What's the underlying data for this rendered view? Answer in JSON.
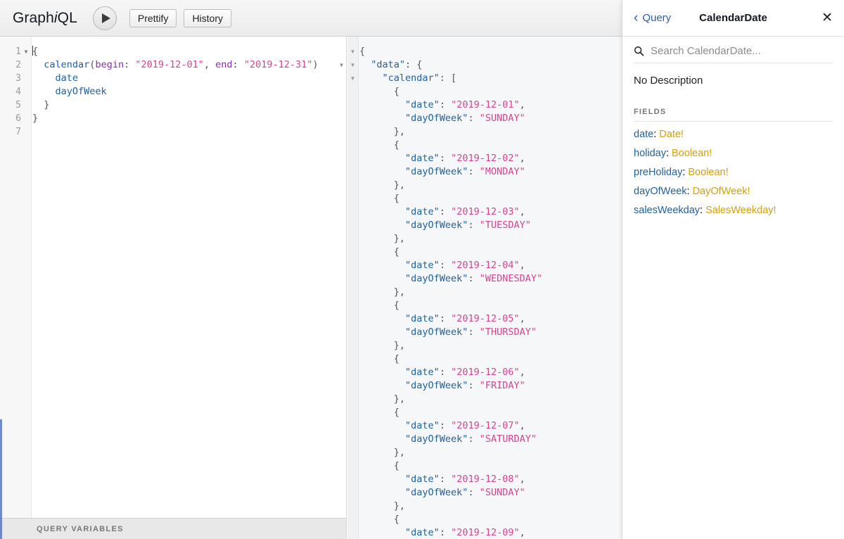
{
  "toolbar": {
    "logo_prefix": "Graph",
    "logo_italic": "i",
    "logo_suffix": "QL",
    "execute_label": "execute-query",
    "prettify_label": "Prettify",
    "history_label": "History"
  },
  "query_editor": {
    "line_numbers": [
      "1",
      "2",
      "3",
      "4",
      "5",
      "6",
      "7"
    ],
    "fold_marker": "▼",
    "lines": [
      {
        "indent": 0,
        "parts": [
          {
            "t": "{",
            "c": "punct"
          }
        ]
      },
      {
        "indent": 1,
        "parts": [
          {
            "t": "calendar",
            "c": "field"
          },
          {
            "t": "(",
            "c": "punct"
          },
          {
            "t": "begin",
            "c": "arg"
          },
          {
            "t": ": ",
            "c": "punct"
          },
          {
            "t": "\"2019-12-01\"",
            "c": "str"
          },
          {
            "t": ", ",
            "c": "punct"
          },
          {
            "t": "end",
            "c": "arg"
          },
          {
            "t": ": ",
            "c": "punct"
          },
          {
            "t": "\"2019-12-31\"",
            "c": "str"
          },
          {
            "t": ")",
            "c": "punct"
          }
        ]
      },
      {
        "indent": 2,
        "parts": [
          {
            "t": "date",
            "c": "field"
          }
        ]
      },
      {
        "indent": 2,
        "parts": [
          {
            "t": "dayOfWeek",
            "c": "field"
          }
        ]
      },
      {
        "indent": 1,
        "parts": [
          {
            "t": "}",
            "c": "punct"
          }
        ]
      },
      {
        "indent": 0,
        "parts": [
          {
            "t": "}",
            "c": "punct"
          }
        ]
      },
      {
        "indent": 0,
        "parts": []
      }
    ],
    "variables_label": "QUERY VARIABLES"
  },
  "result": {
    "fold_markers": [
      "▼",
      "▼",
      "▼"
    ],
    "lines": [
      {
        "indent": 0,
        "parts": [
          {
            "t": "{",
            "c": "pun"
          }
        ]
      },
      {
        "indent": 1,
        "parts": [
          {
            "t": "\"data\"",
            "c": "key"
          },
          {
            "t": ": {",
            "c": "pun"
          }
        ]
      },
      {
        "indent": 2,
        "parts": [
          {
            "t": "\"calendar\"",
            "c": "key"
          },
          {
            "t": ": [",
            "c": "pun"
          }
        ]
      },
      {
        "indent": 3,
        "parts": [
          {
            "t": "{",
            "c": "pun"
          }
        ]
      },
      {
        "indent": 4,
        "parts": [
          {
            "t": "\"date\"",
            "c": "key"
          },
          {
            "t": ": ",
            "c": "pun"
          },
          {
            "t": "\"2019-12-01\"",
            "c": "str"
          },
          {
            "t": ",",
            "c": "pun"
          }
        ]
      },
      {
        "indent": 4,
        "parts": [
          {
            "t": "\"dayOfWeek\"",
            "c": "key"
          },
          {
            "t": ": ",
            "c": "pun"
          },
          {
            "t": "\"SUNDAY\"",
            "c": "str"
          }
        ]
      },
      {
        "indent": 3,
        "parts": [
          {
            "t": "},",
            "c": "pun"
          }
        ]
      },
      {
        "indent": 3,
        "parts": [
          {
            "t": "{",
            "c": "pun"
          }
        ]
      },
      {
        "indent": 4,
        "parts": [
          {
            "t": "\"date\"",
            "c": "key"
          },
          {
            "t": ": ",
            "c": "pun"
          },
          {
            "t": "\"2019-12-02\"",
            "c": "str"
          },
          {
            "t": ",",
            "c": "pun"
          }
        ]
      },
      {
        "indent": 4,
        "parts": [
          {
            "t": "\"dayOfWeek\"",
            "c": "key"
          },
          {
            "t": ": ",
            "c": "pun"
          },
          {
            "t": "\"MONDAY\"",
            "c": "str"
          }
        ]
      },
      {
        "indent": 3,
        "parts": [
          {
            "t": "},",
            "c": "pun"
          }
        ]
      },
      {
        "indent": 3,
        "parts": [
          {
            "t": "{",
            "c": "pun"
          }
        ]
      },
      {
        "indent": 4,
        "parts": [
          {
            "t": "\"date\"",
            "c": "key"
          },
          {
            "t": ": ",
            "c": "pun"
          },
          {
            "t": "\"2019-12-03\"",
            "c": "str"
          },
          {
            "t": ",",
            "c": "pun"
          }
        ]
      },
      {
        "indent": 4,
        "parts": [
          {
            "t": "\"dayOfWeek\"",
            "c": "key"
          },
          {
            "t": ": ",
            "c": "pun"
          },
          {
            "t": "\"TUESDAY\"",
            "c": "str"
          }
        ]
      },
      {
        "indent": 3,
        "parts": [
          {
            "t": "},",
            "c": "pun"
          }
        ]
      },
      {
        "indent": 3,
        "parts": [
          {
            "t": "{",
            "c": "pun"
          }
        ]
      },
      {
        "indent": 4,
        "parts": [
          {
            "t": "\"date\"",
            "c": "key"
          },
          {
            "t": ": ",
            "c": "pun"
          },
          {
            "t": "\"2019-12-04\"",
            "c": "str"
          },
          {
            "t": ",",
            "c": "pun"
          }
        ]
      },
      {
        "indent": 4,
        "parts": [
          {
            "t": "\"dayOfWeek\"",
            "c": "key"
          },
          {
            "t": ": ",
            "c": "pun"
          },
          {
            "t": "\"WEDNESDAY\"",
            "c": "str"
          }
        ]
      },
      {
        "indent": 3,
        "parts": [
          {
            "t": "},",
            "c": "pun"
          }
        ]
      },
      {
        "indent": 3,
        "parts": [
          {
            "t": "{",
            "c": "pun"
          }
        ]
      },
      {
        "indent": 4,
        "parts": [
          {
            "t": "\"date\"",
            "c": "key"
          },
          {
            "t": ": ",
            "c": "pun"
          },
          {
            "t": "\"2019-12-05\"",
            "c": "str"
          },
          {
            "t": ",",
            "c": "pun"
          }
        ]
      },
      {
        "indent": 4,
        "parts": [
          {
            "t": "\"dayOfWeek\"",
            "c": "key"
          },
          {
            "t": ": ",
            "c": "pun"
          },
          {
            "t": "\"THURSDAY\"",
            "c": "str"
          }
        ]
      },
      {
        "indent": 3,
        "parts": [
          {
            "t": "},",
            "c": "pun"
          }
        ]
      },
      {
        "indent": 3,
        "parts": [
          {
            "t": "{",
            "c": "pun"
          }
        ]
      },
      {
        "indent": 4,
        "parts": [
          {
            "t": "\"date\"",
            "c": "key"
          },
          {
            "t": ": ",
            "c": "pun"
          },
          {
            "t": "\"2019-12-06\"",
            "c": "str"
          },
          {
            "t": ",",
            "c": "pun"
          }
        ]
      },
      {
        "indent": 4,
        "parts": [
          {
            "t": "\"dayOfWeek\"",
            "c": "key"
          },
          {
            "t": ": ",
            "c": "pun"
          },
          {
            "t": "\"FRIDAY\"",
            "c": "str"
          }
        ]
      },
      {
        "indent": 3,
        "parts": [
          {
            "t": "},",
            "c": "pun"
          }
        ]
      },
      {
        "indent": 3,
        "parts": [
          {
            "t": "{",
            "c": "pun"
          }
        ]
      },
      {
        "indent": 4,
        "parts": [
          {
            "t": "\"date\"",
            "c": "key"
          },
          {
            "t": ": ",
            "c": "pun"
          },
          {
            "t": "\"2019-12-07\"",
            "c": "str"
          },
          {
            "t": ",",
            "c": "pun"
          }
        ]
      },
      {
        "indent": 4,
        "parts": [
          {
            "t": "\"dayOfWeek\"",
            "c": "key"
          },
          {
            "t": ": ",
            "c": "pun"
          },
          {
            "t": "\"SATURDAY\"",
            "c": "str"
          }
        ]
      },
      {
        "indent": 3,
        "parts": [
          {
            "t": "},",
            "c": "pun"
          }
        ]
      },
      {
        "indent": 3,
        "parts": [
          {
            "t": "{",
            "c": "pun"
          }
        ]
      },
      {
        "indent": 4,
        "parts": [
          {
            "t": "\"date\"",
            "c": "key"
          },
          {
            "t": ": ",
            "c": "pun"
          },
          {
            "t": "\"2019-12-08\"",
            "c": "str"
          },
          {
            "t": ",",
            "c": "pun"
          }
        ]
      },
      {
        "indent": 4,
        "parts": [
          {
            "t": "\"dayOfWeek\"",
            "c": "key"
          },
          {
            "t": ": ",
            "c": "pun"
          },
          {
            "t": "\"SUNDAY\"",
            "c": "str"
          }
        ]
      },
      {
        "indent": 3,
        "parts": [
          {
            "t": "},",
            "c": "pun"
          }
        ]
      },
      {
        "indent": 3,
        "parts": [
          {
            "t": "{",
            "c": "pun"
          }
        ]
      },
      {
        "indent": 4,
        "parts": [
          {
            "t": "\"date\"",
            "c": "key"
          },
          {
            "t": ": ",
            "c": "pun"
          },
          {
            "t": "\"2019-12-09\"",
            "c": "str"
          },
          {
            "t": ",",
            "c": "pun"
          }
        ]
      }
    ]
  },
  "docs": {
    "back_label": "Query",
    "title": "CalendarDate",
    "close_label": "✕",
    "search_placeholder": "Search CalendarDate...",
    "description": "No Description",
    "fields_heading": "FIELDS",
    "fields": [
      {
        "name": "date",
        "type": "Date",
        "nonnull": "!"
      },
      {
        "name": "holiday",
        "type": "Boolean",
        "nonnull": "!"
      },
      {
        "name": "preHoliday",
        "type": "Boolean",
        "nonnull": "!"
      },
      {
        "name": "dayOfWeek",
        "type": "DayOfWeek",
        "nonnull": "!"
      },
      {
        "name": "salesWeekday",
        "type": "SalesWeekday",
        "nonnull": "!"
      }
    ]
  }
}
